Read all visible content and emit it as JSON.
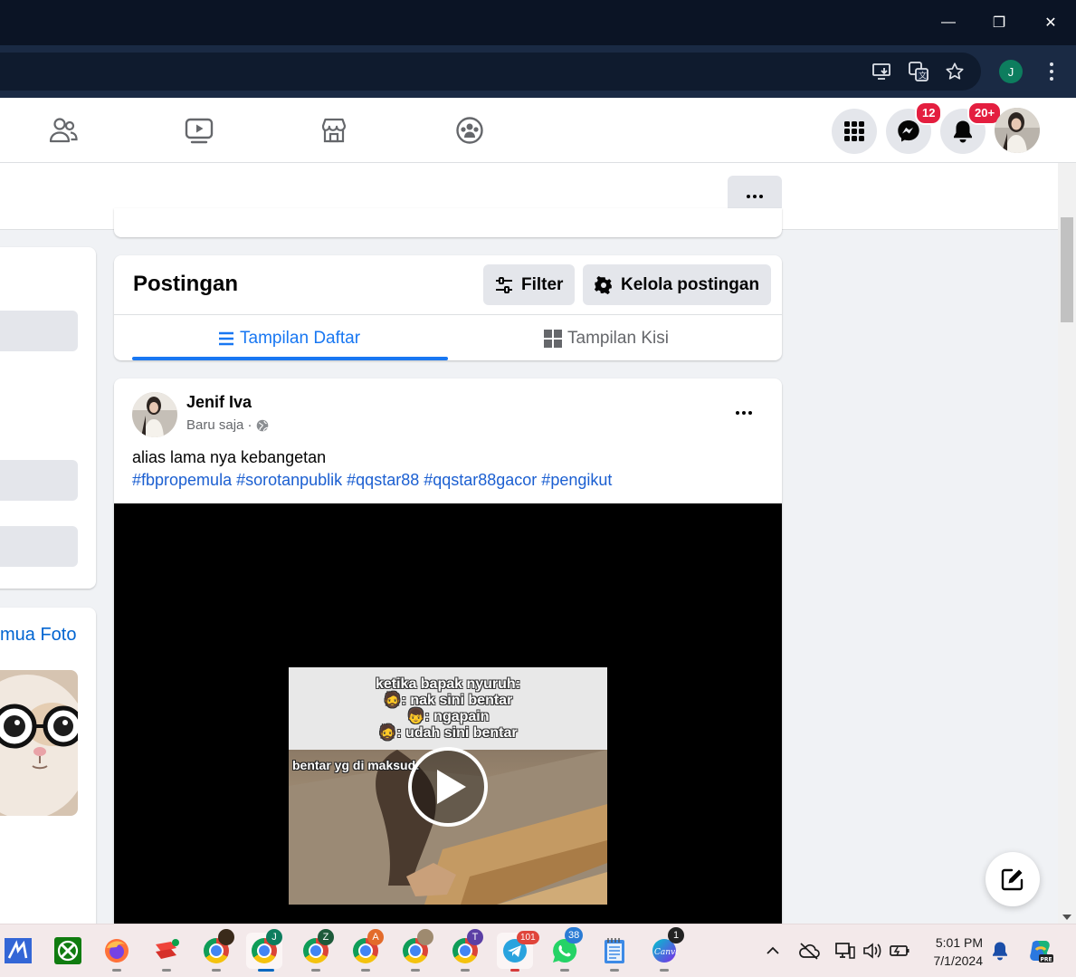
{
  "window": {
    "minimize_label": "—",
    "maximize_label": "❐",
    "close_label": "✕"
  },
  "browser": {
    "profile_initial": "J"
  },
  "fb_nav": {
    "messenger_badge": "12",
    "notifications_badge": "20+"
  },
  "left_column": {
    "photos_link": "mua Foto"
  },
  "postingan": {
    "title": "Postingan",
    "filter_label": "Filter",
    "manage_label": "Kelola postingan",
    "tabs": [
      {
        "label": "Tampilan Daftar",
        "active": true
      },
      {
        "label": "Tampilan Kisi",
        "active": false
      }
    ]
  },
  "post": {
    "author": "Jenif Iva",
    "time": "Baru saja ·",
    "text": "alias lama nya kebangetan",
    "hashtags": "#fbpropemula #sorotanpublik #qqstar88 #qqstar88gacor #pengikut",
    "video": {
      "overlay_lines": [
        "ketika bapak nyuruh:",
        "🧔: nak sini bentar",
        "👦: ngapain",
        "🧔: udah sini bentar"
      ],
      "caption": "bentar yg di maksud:"
    }
  },
  "taskbar": {
    "badges": {
      "chrome_j": "J",
      "chrome_z": "Z",
      "chrome_a": "A",
      "chrome_t": "T",
      "telegram": "101",
      "whatsapp": "38",
      "canva": "1"
    },
    "time": "5:01 PM",
    "date": "7/1/2024"
  },
  "colors": {
    "accent": "#1877f2",
    "badge": "#e41e3f",
    "link": "#1b5fd1"
  }
}
